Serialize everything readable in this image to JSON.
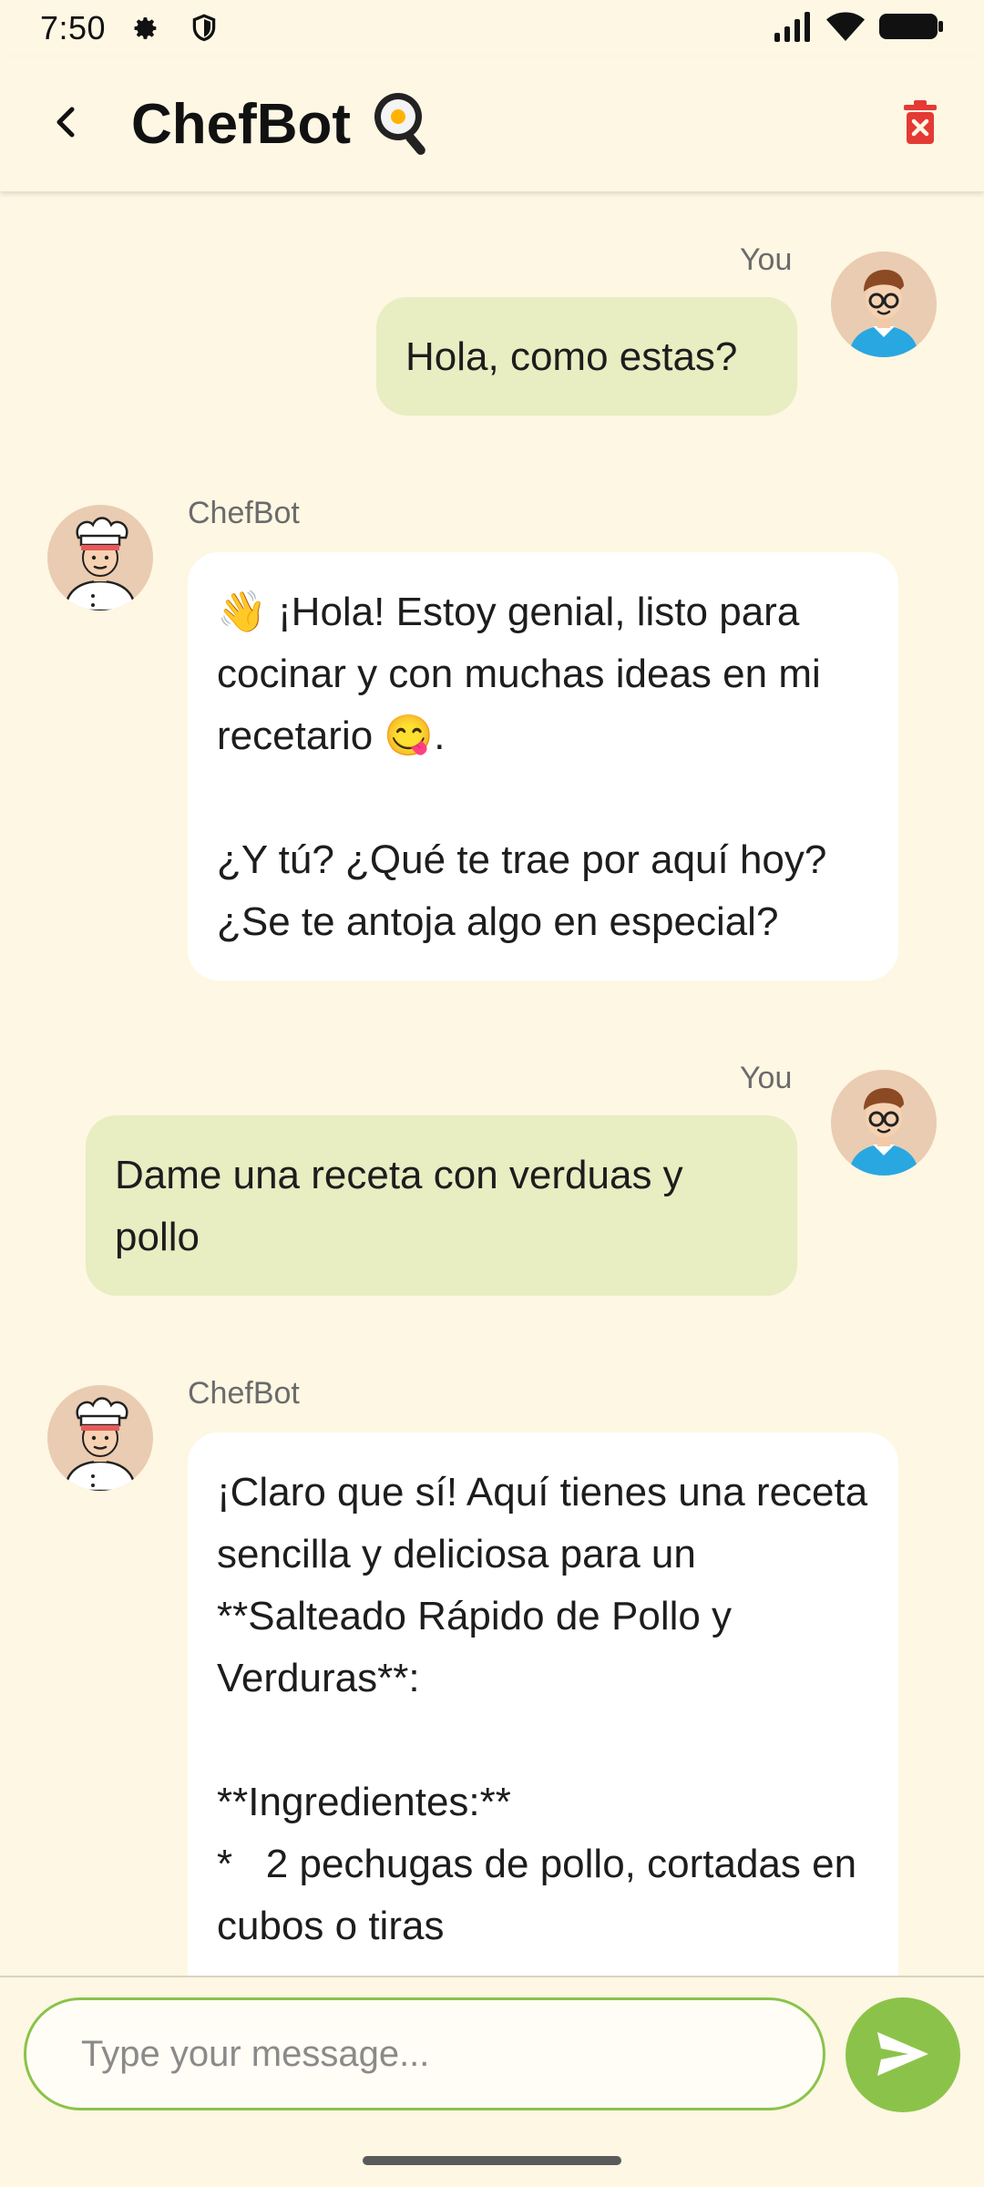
{
  "status_bar": {
    "time": "7:50",
    "icons": [
      "gear-icon",
      "shield-icon",
      "signal-icon",
      "wifi-icon",
      "battery-icon"
    ]
  },
  "app_bar": {
    "title": "ChefBot",
    "title_emoji": "magnifying-glass-frying-pan-icon",
    "back_icon": "back-arrow-icon",
    "delete_icon": "trash-icon",
    "delete_color": "#e53935"
  },
  "messages": [
    {
      "sender": "You",
      "role": "user",
      "text": "Hola, como estas?"
    },
    {
      "sender": "ChefBot",
      "role": "bot",
      "text": "👋 ¡Hola! Estoy genial, listo para cocinar y con muchas ideas en mi recetario 😋.\n\n¿Y tú? ¿Qué te trae por aquí hoy? ¿Se te antoja algo en especial?"
    },
    {
      "sender": "You",
      "role": "user",
      "text": "Dame una receta con verduas y pollo"
    },
    {
      "sender": "ChefBot",
      "role": "bot",
      "text": "¡Claro que sí! Aquí tienes una receta sencilla y deliciosa para un **Salteado Rápido de Pollo y Verduras**:\n\n**Ingredientes:**\n*   2 pechugas de pollo, cortadas en cubos o tiras"
    }
  ],
  "composer": {
    "placeholder": "Type your message...",
    "send_icon": "send-icon",
    "accent": "#8bc34a"
  },
  "colors": {
    "background": "#fdf7e3",
    "user_bubble": "#e8edc2",
    "bot_bubble": "#ffffff"
  }
}
